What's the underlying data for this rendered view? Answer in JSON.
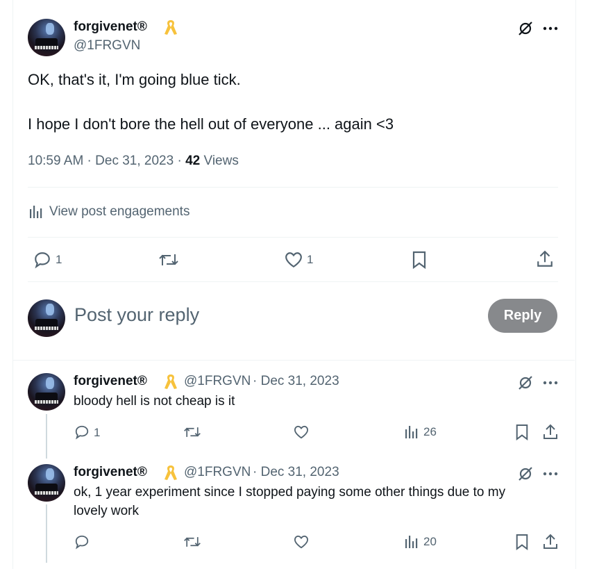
{
  "main_post": {
    "display_name": "forgivenet®",
    "handle": "@1FRGVN",
    "line1": "OK, that's it, I'm going blue tick.",
    "line2": "I hope I don't bore the hell out of everyone ... again <3",
    "time": "10:59 AM · Dec 31, 2023 · ",
    "views_count": "42",
    "views_label": " Views",
    "engagements_label": "View post engagements",
    "reply_count": "1",
    "like_count": "1"
  },
  "composer": {
    "placeholder": "Post your reply",
    "reply_button": "Reply"
  },
  "replies": [
    {
      "display_name": "forgivenet®",
      "handle": "@1FRGVN",
      "date": "· Dec 31, 2023",
      "text1": "bloody hell is not cheap is it",
      "text2": "",
      "reply_count": "1",
      "views": "26"
    },
    {
      "display_name": "forgivenet®",
      "handle": "@1FRGVN",
      "date": "· Dec 31, 2023",
      "text1": "ok, 1 year experiment since I stopped paying some other things due to my",
      "text2": "lovely work",
      "reply_count": "",
      "views": "20"
    }
  ],
  "colors": {
    "accent_ribbon": "#f7c23c",
    "secondary_text": "#536471",
    "reply_button_bg": "#87898c"
  },
  "icons": [
    "unmute-icon",
    "more-icon",
    "reply-icon",
    "retweet-icon",
    "like-icon",
    "bookmark-icon",
    "share-icon",
    "analytics-icon",
    "awareness-ribbon-icon"
  ]
}
